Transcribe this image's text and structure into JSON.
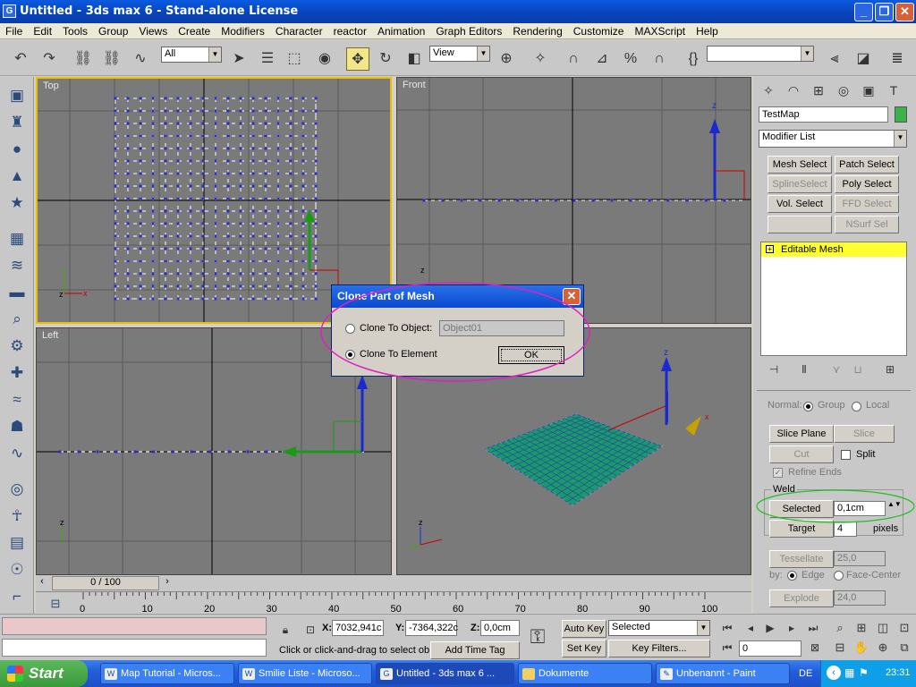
{
  "window": {
    "title": "Untitled - 3ds max 6 - Stand-alone License",
    "app_icon": "G",
    "min_label": "_",
    "max_label": "❐",
    "close_label": "✕"
  },
  "menu": [
    "File",
    "Edit",
    "Tools",
    "Group",
    "Views",
    "Create",
    "Modifiers",
    "Character",
    "reactor",
    "Animation",
    "Graph Editors",
    "Rendering",
    "Customize",
    "MAXScript",
    "Help"
  ],
  "toolbar": {
    "selection_filter": "All",
    "ref_coord": "View",
    "named_selection": ""
  },
  "viewports": {
    "top": "Top",
    "front": "Front",
    "left": "Left",
    "persp": ""
  },
  "axis": {
    "x": "x",
    "y": "y",
    "z": "z"
  },
  "dialog": {
    "title": "Clone Part of Mesh",
    "opt1": "Clone To Object:",
    "opt1_value": "Object01",
    "opt2": "Clone To Element",
    "ok": "OK",
    "selected": "Clone To Element"
  },
  "command_panel": {
    "object_name": "TestMap",
    "object_color": "#3cb34a",
    "modifier_list": "Modifier List",
    "buttons": [
      "Mesh Select",
      "Patch Select",
      "SplineSelect",
      "Poly Select",
      "Vol. Select",
      "FFD Select",
      "",
      "NSurf Sel"
    ],
    "disabled": [
      "SplineSelect",
      "FFD Select",
      "NSurf Sel"
    ],
    "stack_item": "Editable Mesh",
    "normal_label": "Normal:",
    "group_label": "Group",
    "local_label": "Local",
    "slice_plane": "Slice Plane",
    "slice": "Slice",
    "cut": "Cut",
    "split": "Split",
    "refine_ends": "Refine Ends",
    "weld": "Weld",
    "weld_selected": "Selected",
    "weld_threshold": "0,1cm",
    "target": "Target",
    "target_pixels": "4",
    "pixels": "pixels",
    "tessellate": "Tessellate",
    "tess_value": "25,0",
    "by": "by:",
    "edge": "Edge",
    "face_center": "Face-Center",
    "explode": "Explode",
    "explode_value": "24,0"
  },
  "timeline": {
    "slider": "0 / 100",
    "ticks": [
      "0",
      "10",
      "20",
      "30",
      "40",
      "50",
      "60",
      "70",
      "80",
      "90",
      "100"
    ]
  },
  "status": {
    "x": "7032,941c",
    "y": "-7364,322c",
    "z": "0,0cm",
    "prompt": "Click or click-and-drag to select ob",
    "add_time_tag": "Add Time Tag",
    "auto_key": "Auto Key",
    "set_key": "Set Key",
    "key_mode": "Selected",
    "key_filters": "Key Filters...",
    "frame": "0"
  },
  "taskbar": {
    "start": "Start",
    "tasks": [
      "Map Tutorial - Micros...",
      "Smilie Liste - Microso...",
      "Untitled - 3ds max 6 ...",
      "Dokumente",
      "Unbenannt - Paint"
    ],
    "lang": "DE",
    "clock": "23:31"
  }
}
